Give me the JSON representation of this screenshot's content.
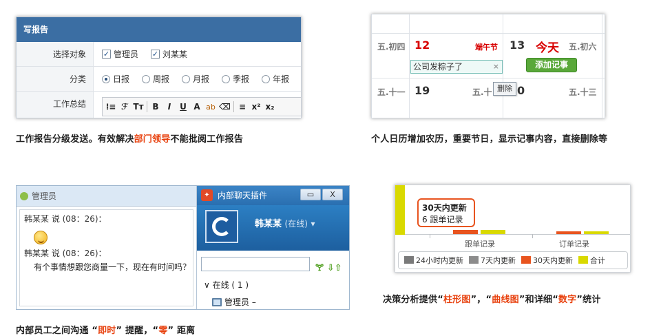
{
  "report": {
    "header": "写报告",
    "rows": [
      {
        "label": "选择对象",
        "options": [
          "管理员",
          "刘某某"
        ]
      },
      {
        "label": "分类",
        "options": [
          "日报",
          "周报",
          "月报",
          "季报",
          "年报"
        ],
        "selected": "日报"
      },
      {
        "label": "工作总结"
      }
    ],
    "toolbar": [
      "B",
      "I",
      "U",
      "A",
      "ab",
      "x²",
      "x₂"
    ],
    "caption": {
      "pre": "工作报告分级发送。有效解决",
      "hl": "部门领导",
      "post": "不能批阅工作报告"
    }
  },
  "calendar": {
    "row1": {
      "lunar_left": "五.初四",
      "day1": "12",
      "festival": "端午节",
      "day2": "13",
      "today": "今天",
      "lunar_right": "五.初六"
    },
    "note": "公司发粽子了",
    "note_close": "×",
    "add_button": "添加记事",
    "row2": {
      "lunar_left": "五.十一",
      "day1": "19",
      "lunar_mid": "五.十",
      "day2": "0",
      "lunar_right": "五.十三"
    },
    "delete_button": "删除",
    "caption": "个人日历增加农历，重要节日，显示记事内容，直接删除等"
  },
  "chat": {
    "left_title": "管理员",
    "msg1_header": "韩某某 说 (08：26)：",
    "msg2_header": "韩某某 说 (08：26)：",
    "msg2_text": "有个事情想跟您商量一下，现在有时间吗？",
    "plugin_title": "内部聊天插件",
    "win_min": "▭",
    "win_close": "X",
    "user_name": "韩某某",
    "user_status": "(在线)",
    "group_label": "∨ 在线 ( 1 )",
    "member": "管理员 –",
    "tools": "🝖 ⇩⇧",
    "caption": {
      "pre": "内部员工之间沟通 “",
      "hl1": "即时",
      "mid": "” 提醒，“",
      "hl2": "零",
      "post": "” 距离"
    }
  },
  "stats": {
    "tooltip_title": "30天内更新",
    "tooltip_value": "6 跟单记录",
    "caption": {
      "p1": "决策分析提供“",
      "h1": "柱形图",
      "p2": "”，“",
      "h2": "曲线图",
      "p3": "”和详细“",
      "h3": "数字",
      "p4": "”统计"
    }
  },
  "chart_data": {
    "type": "bar",
    "categories": [
      "跟单记录",
      "订单记录"
    ],
    "series": [
      {
        "name": "24小时内更新",
        "color": "#7a7a7a",
        "values": [
          0,
          0
        ]
      },
      {
        "name": "7天内更新",
        "color": "#8c8c8c",
        "values": [
          0,
          0
        ]
      },
      {
        "name": "30天内更新",
        "color": "#e8541f",
        "values": [
          6,
          1
        ]
      },
      {
        "name": "合计",
        "color": "#d9d900",
        "values": [
          6,
          1
        ]
      }
    ],
    "legend_position": "bottom"
  }
}
